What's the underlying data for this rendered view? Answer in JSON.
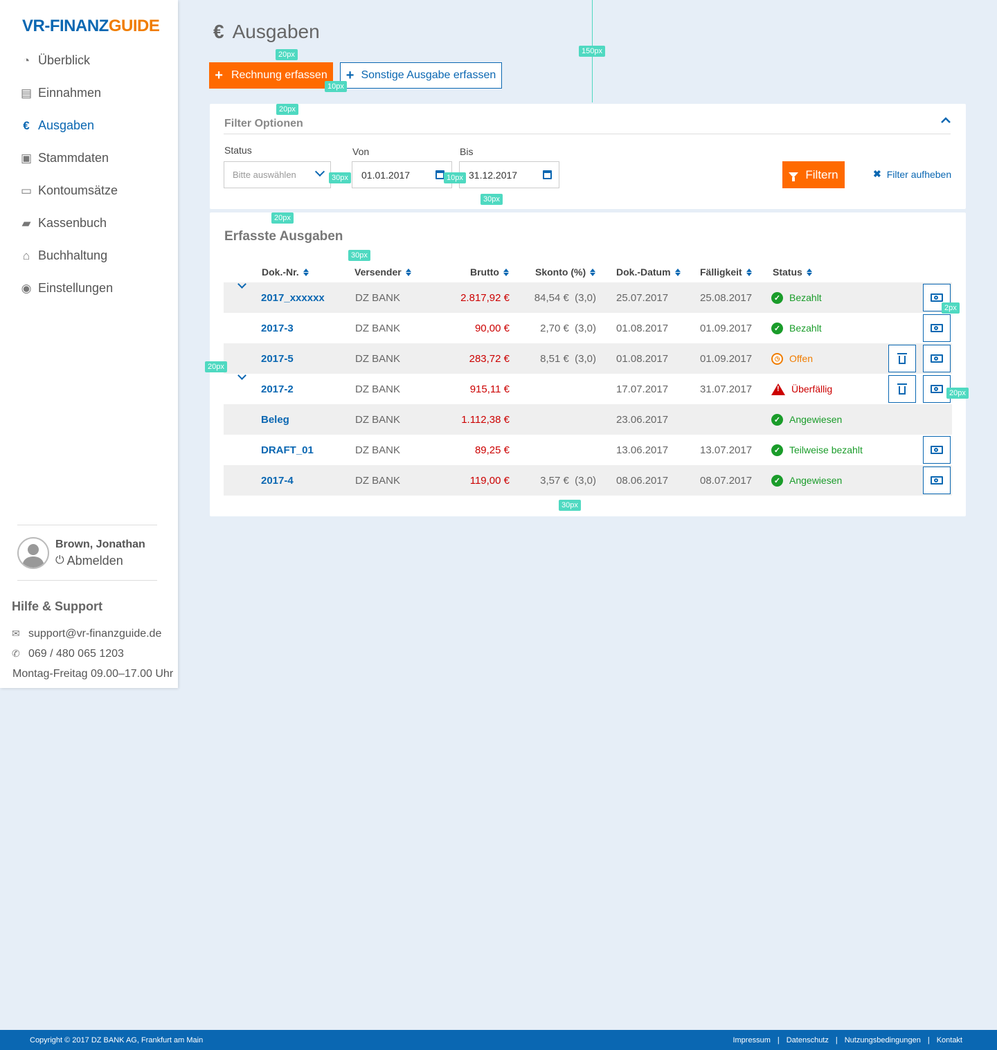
{
  "brand": {
    "part1": "VR-FINANZ",
    "part2": "GUIDE",
    "color1": "#0a67b2",
    "color2": "#f07d00"
  },
  "nav": [
    {
      "label": "Überblick",
      "icon": "dashboard-icon",
      "active": false
    },
    {
      "label": "Einnahmen",
      "icon": "document-icon",
      "active": false
    },
    {
      "label": "Ausgaben",
      "icon": "euro-icon",
      "active": true
    },
    {
      "label": "Stammdaten",
      "icon": "contact-book-icon",
      "active": false
    },
    {
      "label": "Kontoumsätze",
      "icon": "credit-card-icon",
      "active": false
    },
    {
      "label": "Kassenbuch",
      "icon": "book-icon",
      "active": false
    },
    {
      "label": "Buchhaltung",
      "icon": "bank-icon",
      "active": false
    },
    {
      "label": "Einstellungen",
      "icon": "user-circle-icon",
      "active": false
    }
  ],
  "user": {
    "name": "Brown, Jonathan",
    "logout": "Abmelden"
  },
  "help": {
    "title": "Hilfe & Support",
    "email": "support@vr-finanzguide.de",
    "phone": "069 / 480 065 1203",
    "hours": "Montag-Freitag 09.00–17.00 Uhr"
  },
  "page": {
    "title": "Ausgaben"
  },
  "actions": {
    "primary": "Rechnung erfassen",
    "secondary": "Sonstige Ausgabe erfassen"
  },
  "filter": {
    "title": "Filter Optionen",
    "status_label": "Status",
    "status_placeholder": "Bitte auswählen",
    "from_label": "Von",
    "from_value": "01.01.2017",
    "to_label": "Bis",
    "to_value": "31.12.2017",
    "apply": "Filtern",
    "reset": "Filter aufheben"
  },
  "list": {
    "title": "Erfasste Ausgaben",
    "columns": [
      "Dok.-Nr.",
      "Versender",
      "Brutto",
      "Skonto (%)",
      "Dok.-Datum",
      "Fälligkeit",
      "Status"
    ],
    "rows": [
      {
        "doknr": "2017_xxxxxx",
        "vers": "DZ BANK",
        "brutto": "2.817,92 €",
        "skonto": "84,54 €  (3,0)",
        "dokdat": "25.07.2017",
        "faell": "25.08.2017",
        "status": "Bezahlt",
        "stype": "ok"
      },
      {
        "doknr": "2017-3",
        "vers": "DZ BANK",
        "brutto": "90,00 €",
        "skonto": "2,70 €  (3,0)",
        "dokdat": "01.08.2017",
        "faell": "01.09.2017",
        "status": "Bezahlt",
        "stype": "ok"
      },
      {
        "doknr": "2017-5",
        "vers": "DZ BANK",
        "brutto": "283,72 €",
        "skonto": "8,51 €  (3,0)",
        "dokdat": "01.08.2017",
        "faell": "01.09.2017",
        "status": "Offen",
        "stype": "open"
      },
      {
        "doknr": "2017-2",
        "vers": "DZ BANK",
        "brutto": "915,11 €",
        "skonto": "",
        "dokdat": "17.07.2017",
        "faell": "31.07.2017",
        "status": "Überfällig",
        "stype": "warn"
      },
      {
        "doknr": "Beleg",
        "vers": "DZ BANK",
        "brutto": "1.112,38 €",
        "skonto": "",
        "dokdat": "23.06.2017",
        "faell": "",
        "status": "Angewiesen",
        "stype": "ok"
      },
      {
        "doknr": "DRAFT_01",
        "vers": "DZ BANK",
        "brutto": "89,25 €",
        "skonto": "",
        "dokdat": "13.06.2017",
        "faell": "13.07.2017",
        "status": "Teilweise bezahlt",
        "stype": "ok"
      },
      {
        "doknr": "2017-4",
        "vers": "DZ BANK",
        "brutto": "119,00 €",
        "skonto": "3,57 €  (3,0)",
        "dokdat": "08.06.2017",
        "faell": "08.07.2017",
        "status": "Angewiesen",
        "stype": "ok"
      }
    ]
  },
  "spec_tags": {
    "t150": "150px",
    "t20": "20px",
    "t10": "10px",
    "t30": "30px",
    "t2": "2px"
  },
  "footer": {
    "copyright": "Copyright © 2017 DZ BANK AG, Frankfurt am Main",
    "links": [
      "Impressum",
      "Datenschutz",
      "Nutzungsbedingungen",
      "Kontakt"
    ],
    "separator": "|"
  }
}
